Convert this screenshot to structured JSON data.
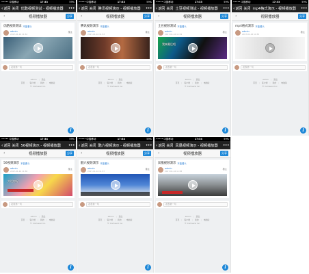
{
  "screens": [
    {
      "status": {
        "carrier": "••••• 中国移动",
        "time": "17:33",
        "battery": "59%"
      },
      "nav": {
        "back": "返回",
        "close": "关闭",
        "title": "优酷视频测试 - 视频播放器"
      },
      "header": {
        "title": "视频播放器",
        "share": "分享"
      },
      "post": {
        "title": "优酷视频测试",
        "tag": "不能看么",
        "author": "admin",
        "time": "2017-01-16 11:52",
        "reply": "楼主"
      },
      "comment": {
        "placeholder": "发表第一句"
      },
      "footer": {
        "user": "admin",
        "logout": "退出",
        "links": [
          "首页",
          "客户端",
          "我的",
          "电脑版"
        ],
        "copyright": "© Comsenz Inc."
      }
    },
    {
      "status": {
        "carrier": "••••• 中国移动",
        "time": "17:33",
        "battery": "59%"
      },
      "nav": {
        "back": "返回",
        "close": "关闭",
        "title": "腾讯视频演示 - 视频播放器"
      },
      "header": {
        "title": "视频播放器",
        "share": "分享"
      },
      "post": {
        "title": "腾讯视频演示",
        "tag": "不能看么",
        "author": "admin",
        "time": "2017-01-16 11:53",
        "reply": "楼主"
      },
      "comment": {
        "placeholder": "发表第一句"
      },
      "footer": {
        "user": "admin",
        "logout": "退出",
        "links": [
          "首页",
          "客户端",
          "我的",
          "电脑版"
        ],
        "copyright": "© Comsenz Inc."
      }
    },
    {
      "status": {
        "carrier": "••••• 中国移动",
        "time": "17:33",
        "battery": "59%"
      },
      "nav": {
        "back": "返回",
        "close": "关闭",
        "title": "土豆视频测试 - 视频播放器"
      },
      "header": {
        "title": "视频播放器",
        "share": "分享"
      },
      "post": {
        "title": "土豆视频测试",
        "tag": "不能看么",
        "author": "admin",
        "time": "2017-01-16 11:54",
        "reply": "楼主"
      },
      "comment": {
        "placeholder": "发表第一句"
      },
      "footer": {
        "user": "admin",
        "logout": "退出",
        "links": [
          "首页",
          "客户端",
          "我的",
          "电脑版"
        ],
        "copyright": "© Comsenz Inc."
      }
    },
    {
      "status": {
        "carrier": "••••• 中国移动",
        "time": "17:33",
        "battery": "59%"
      },
      "nav": {
        "back": "返回",
        "close": "关闭",
        "title": "mp4格式演示 - 视频播放器"
      },
      "header": {
        "title": "视频播放器",
        "share": "分享"
      },
      "post": {
        "title": "mp4格式演示",
        "tag": "不能看么",
        "author": "admin",
        "time": "2017-01-16 11:55",
        "reply": "楼主"
      },
      "comment": {
        "placeholder": "发表第一句"
      },
      "footer": {
        "user": "admin",
        "logout": "退出",
        "links": [
          "首页",
          "客户端",
          "我的",
          "电脑版"
        ],
        "copyright": "© Comsenz Inc."
      }
    },
    {
      "status": {
        "carrier": "••••• 中国移动",
        "time": "17:34",
        "battery": "59%"
      },
      "nav": {
        "back": "返回",
        "close": "关闭",
        "title": "56视频演示 - 视频播放器"
      },
      "header": {
        "title": "视频播放器",
        "share": "分享"
      },
      "post": {
        "title": "56视频演示",
        "tag": "不能看么",
        "author": "admin",
        "time": "2017-01-16 11:56",
        "reply": "楼主"
      },
      "comment": {
        "placeholder": "发表第一句"
      },
      "footer": {
        "user": "admin",
        "logout": "退出",
        "links": [
          "首页",
          "客户端",
          "我的",
          "电脑版"
        ],
        "copyright": "© Comsenz Inc."
      }
    },
    {
      "status": {
        "carrier": "••••• 中国移动",
        "time": "17:34",
        "battery": "59%"
      },
      "nav": {
        "back": "返回",
        "close": "关闭",
        "title": "酷六视频演示 - 视频播放器"
      },
      "header": {
        "title": "视频播放器",
        "share": "分享"
      },
      "post": {
        "title": "酷六视频演示",
        "tag": "不能看么",
        "author": "admin",
        "time": "2017-01-16 11:57",
        "reply": "楼主"
      },
      "comment": {
        "placeholder": "发表第一句"
      },
      "footer": {
        "user": "admin",
        "logout": "退出",
        "links": [
          "首页",
          "客户端",
          "我的",
          "电脑版"
        ],
        "copyright": "© Comsenz Inc."
      }
    },
    {
      "status": {
        "carrier": "••••• 中国移动",
        "time": "17:34",
        "battery": "59%"
      },
      "nav": {
        "back": "返回",
        "close": "关闭",
        "title": "凤凰视频演示 - 视频播放器"
      },
      "header": {
        "title": "视频播放器",
        "share": "分享"
      },
      "post": {
        "title": "凤凰视频演示",
        "tag": "不能看么",
        "author": "admin",
        "time": "2017-01-16 11:58",
        "reply": "楼主"
      },
      "comment": {
        "placeholder": "发表第一句"
      },
      "footer": {
        "user": "admin",
        "logout": "退出",
        "links": [
          "首页",
          "客户端",
          "我的",
          "电脑版"
        ],
        "copyright": "© Comsenz Inc."
      }
    }
  ],
  "videos": [
    {
      "style": "v-car",
      "caption": ""
    },
    {
      "style": "v-cosplay",
      "caption": ""
    },
    {
      "style": "v-stage",
      "caption": "我来最后吧"
    },
    {
      "style": "v-anime",
      "caption": ""
    },
    {
      "style": "v-tv",
      "caption": "大话你好"
    },
    {
      "style": "v-news",
      "caption": ""
    },
    {
      "style": "v-hall",
      "caption": ""
    }
  ],
  "accent": "#1e88d8"
}
